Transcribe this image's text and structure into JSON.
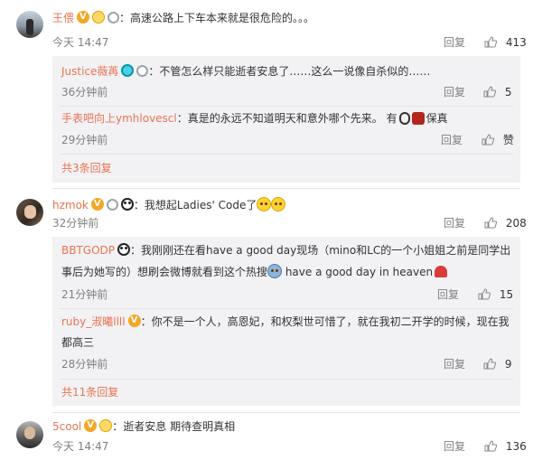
{
  "comments": [
    {
      "user": "王偎",
      "text": "：高速公路上下车本来就是很危险的。。。",
      "time": "今天 14:47",
      "reply_label": "回复",
      "likes": "413",
      "replies": [
        {
          "user": "Justice薇苒",
          "text": "：不管怎么样只能逝者安息了……这么一说像自杀似的……",
          "time": "36分钟前",
          "reply_label": "回复",
          "likes": "5"
        },
        {
          "user": "手表吧向上ymhlovescl",
          "text": "：真是的永远不知道明天和意外哪个先来。 有",
          "tail": "保真",
          "time": "29分钟前",
          "reply_label": "回复",
          "likes": "赞"
        }
      ],
      "more": "共3条回复"
    },
    {
      "user": "hzmok",
      "text": "：我想起Ladies' Code了",
      "time": "32分钟前",
      "reply_label": "回复",
      "likes": "208",
      "replies": [
        {
          "user": "BBTGODP",
          "text_1": "：我刚刚还在看have a good day现场（mino和LC的一个小姐姐之前是同学出",
          "text_2": "事后为她写的）想刷会微博就看到这个热搜",
          "text_2b": " have a good day in heaven",
          "time": "21分钟前",
          "reply_label": "回复",
          "likes": "15"
        },
        {
          "user": "ruby_淑曦llll",
          "text_1": "：你不是一个人，高恩妃，和权梨世可惜了，就在我初二开学的时候，现在我",
          "text_2": "都高三",
          "time": "28分钟前",
          "reply_label": "回复",
          "likes": "9"
        }
      ],
      "more": "共11条回复"
    },
    {
      "user": "5cool",
      "text": "：逝者安息 期待查明真相",
      "time": "今天 14:47",
      "reply_label": "回复",
      "likes": "136"
    }
  ],
  "colors": {
    "username": "#eb7350",
    "meta": "#808080",
    "reply_bg": "#f2f2f5"
  },
  "icons": [
    "vip-badge-icon",
    "fan-badge-icon",
    "medal-icon",
    "panda-icon",
    "emoji-icon",
    "thumb-up-icon",
    "heart-icon",
    "watch-icon"
  ]
}
